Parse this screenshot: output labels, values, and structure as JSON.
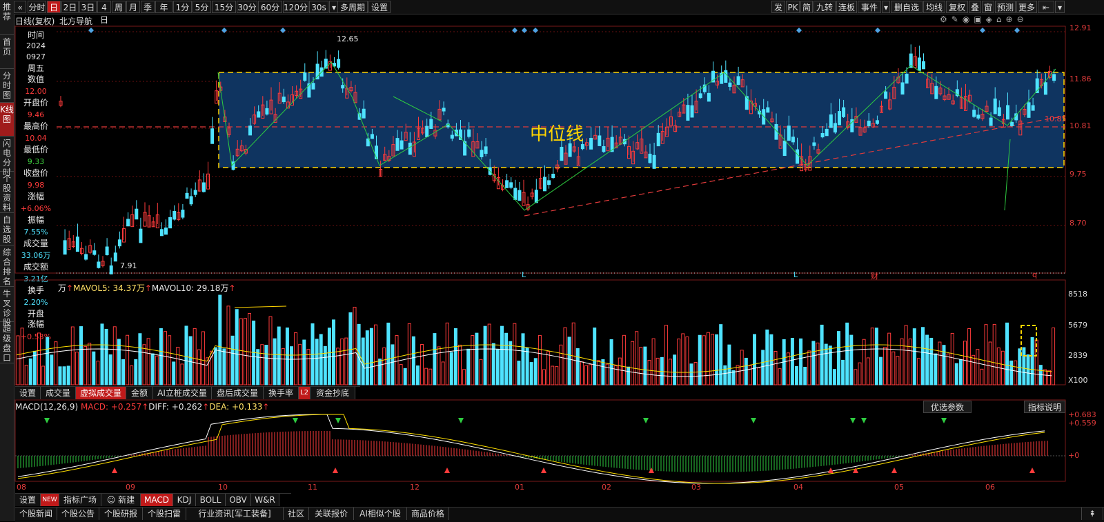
{
  "left_sidebar": [
    "推荐",
    "首页",
    "分时图",
    "K线图",
    "闪电分时",
    "个股资料",
    "自选股",
    "综合排名",
    "牛叉诊股",
    "超级盘口"
  ],
  "top_toolbar": {
    "periods": [
      "分时",
      "日",
      "2日",
      "3日",
      "4日",
      "周",
      "月",
      "季",
      "年",
      "1分",
      "5分",
      "15分",
      "30分",
      "60分",
      "120分",
      "30s"
    ],
    "multi_period": "多周期",
    "settings": "设置",
    "right_items": [
      "发",
      "PK",
      "简",
      "九转",
      "连板",
      "事件",
      "删自选",
      "均线",
      "复权",
      "叠",
      "窗",
      "预测",
      "更多"
    ]
  },
  "header": {
    "chart_type": "日线(复权)",
    "stock_name": "北方导航"
  },
  "info_panel": {
    "time_label": "时间",
    "year": "2024",
    "date": "0927",
    "weekday": "周五",
    "value_label": "数值",
    "value": "12.00",
    "open_label": "开盘价",
    "open": "9.46",
    "high_label": "最高价",
    "high": "10.04",
    "low_label": "最低价",
    "low": "9.33",
    "close_label": "收盘价",
    "close": "9.98",
    "change_label": "涨幅",
    "change": "+6.06%",
    "amplitude_label": "振幅",
    "amplitude": "7.55%",
    "volume_label": "成交量",
    "volume": "33.06万",
    "turnover_label": "成交额",
    "turnover": "3.21亿",
    "turnover_rate_label": "换手",
    "turnover_rate": "2.20%",
    "open_change_label": "开盘\n涨幅",
    "open_change": "+0.53%"
  },
  "price_axis": [
    "12.91",
    "11.86",
    "10.81",
    "9.75",
    "8.70"
  ],
  "price_annotations": {
    "high": "12.65",
    "low": "7.91",
    "mid_value": "10.85",
    "mid_label": "中位线"
  },
  "markers": [
    "L",
    "L",
    "财",
    "q"
  ],
  "volume_header": {
    "unit": "万",
    "mavol5": "MAVOL5: 34.37万",
    "mavol10": "MAVOL10: 29.18万"
  },
  "volume_axis": [
    "8518",
    "5679",
    "2839",
    "X100"
  ],
  "volume_tabs": [
    "设置",
    "成交量",
    "虚拟成交量",
    "金额",
    "AI立桩成交量",
    "盘后成交量",
    "换手率",
    "资金抄底"
  ],
  "l2_badge": "L2",
  "macd_header": {
    "title": "MACD(12,26,9)",
    "macd": "MACD: +0.257",
    "diff": "DIFF: +0.262",
    "dea": "DEA: +0.133"
  },
  "macd_buttons": {
    "params": "优选参数",
    "help": "指标说明"
  },
  "macd_axis": [
    "+0.683",
    "+0.559",
    "+0"
  ],
  "months": [
    "08",
    "09",
    "10",
    "11",
    "12",
    "01",
    "02",
    "03",
    "04",
    "05",
    "06"
  ],
  "indicator_tabs": [
    "设置",
    "指标广场",
    "新建",
    "MACD",
    "KDJ",
    "BOLL",
    "OBV",
    "W&R"
  ],
  "new_badge": "NEW",
  "bottom_tabs": [
    "个股新闻",
    "个股公告",
    "个股研报",
    "个股扫雷",
    "行业资讯[军工装备]",
    "社区",
    "关联报价",
    "AI相似个股",
    "商品价格"
  ],
  "colors": {
    "up": "#ff3b3b",
    "down": "#4fe3ff",
    "box": "#0f3460",
    "box_border": "#ffd400",
    "ma_white": "#ffffff",
    "ma_yellow": "#ffe000",
    "accent": "#c01a1a"
  }
}
